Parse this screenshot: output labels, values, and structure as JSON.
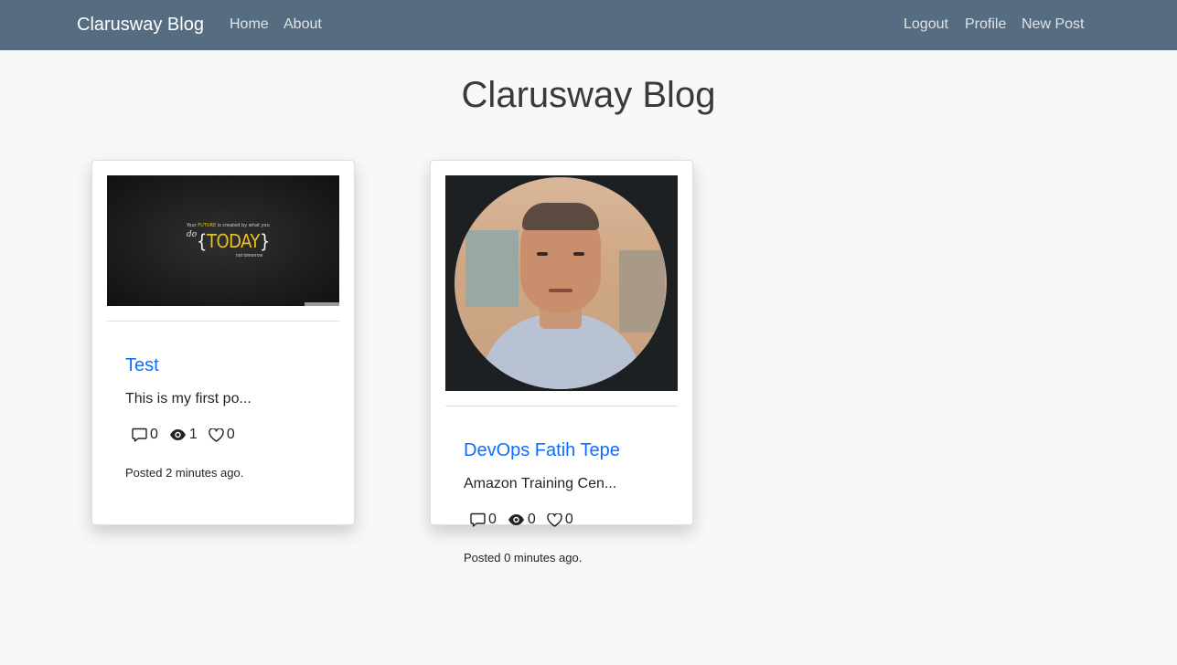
{
  "navbar": {
    "brand": "Clarusway Blog",
    "left_links": [
      "Home",
      "About"
    ],
    "right_links": [
      "Logout",
      "Profile",
      "New Post"
    ]
  },
  "page": {
    "title": "Clarusway Blog"
  },
  "posts": [
    {
      "title": "Test",
      "excerpt": "This is my first po...",
      "comments": "0",
      "views": "1",
      "likes": "0",
      "posted": "Posted 2 minutes ago.",
      "image": {
        "line1_prefix": "Your ",
        "line1_highlight": "FUTURE",
        "line1_suffix": " is created by what you",
        "do": "do",
        "brace_open": "{",
        "word": "TODAY",
        "brace_close": "}",
        "line3": "not tomorrow"
      }
    },
    {
      "title": "DevOps Fatih Tepe",
      "excerpt": "Amazon Training Cen...",
      "comments": "0",
      "views": "0",
      "likes": "0",
      "posted": "Posted 0 minutes ago.",
      "image": {}
    }
  ],
  "icons": {
    "comments": "chat-icon",
    "views": "eye-icon",
    "likes": "heart-icon"
  },
  "colors": {
    "navbar_bg": "#556c81",
    "link": "#0d6efd",
    "page_bg": "#f8f8f8",
    "accent_yellow": "#e8c12a"
  }
}
